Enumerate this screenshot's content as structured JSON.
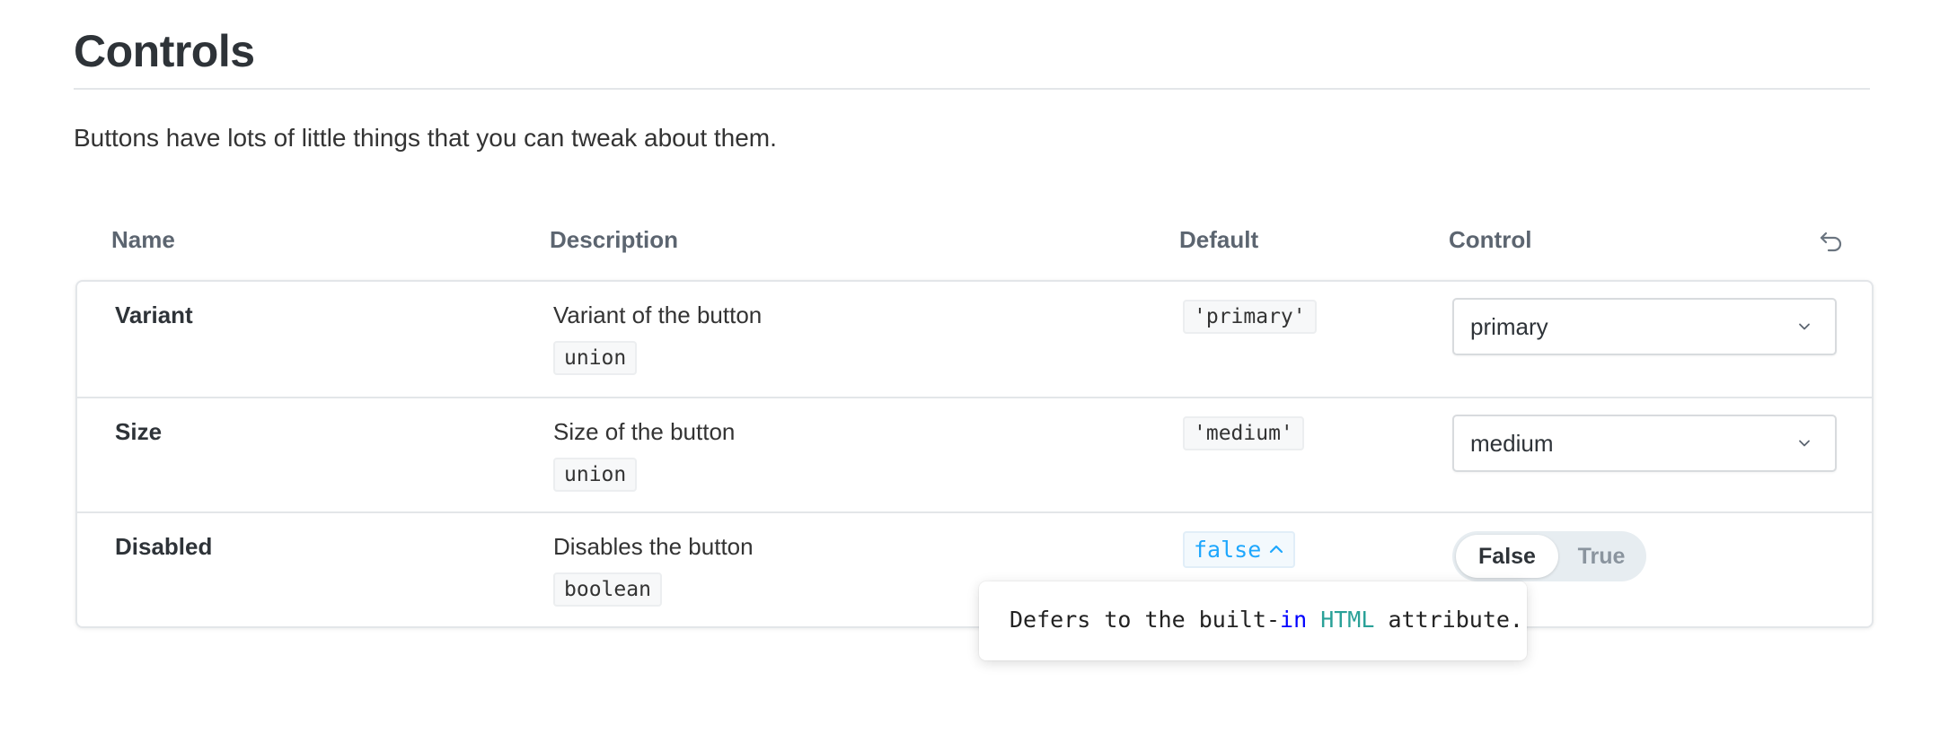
{
  "heading": "Controls",
  "intro": "Buttons have lots of little things that you can tweak about them.",
  "columns": {
    "name": "Name",
    "description": "Description",
    "default": "Default",
    "control": "Control"
  },
  "icons": {
    "reset": "reset-undo-icon",
    "chevron": "chevron-down-icon",
    "expand": "chevron-up-icon"
  },
  "colors": {
    "accent": "#1ea7fd",
    "border": "#e3e6e9",
    "toggle_bg": "#e7edf1"
  },
  "rows": [
    {
      "name": "Variant",
      "description": "Variant of the button",
      "type": "union",
      "default": "'primary'",
      "control": {
        "kind": "select",
        "value": "primary"
      }
    },
    {
      "name": "Size",
      "description": "Size of the button",
      "type": "union",
      "default": "'medium'",
      "control": {
        "kind": "select",
        "value": "medium"
      }
    },
    {
      "name": "Disabled",
      "description": "Disables the button",
      "type": "boolean",
      "default": "false",
      "control": {
        "kind": "boolean-toggle",
        "options": [
          "False",
          "True"
        ],
        "selected": "False"
      }
    }
  ],
  "tooltip": {
    "part1": "Defers to the built-",
    "keyword": "in",
    "space": " ",
    "tag": "HTML",
    "part2": " attribute."
  }
}
